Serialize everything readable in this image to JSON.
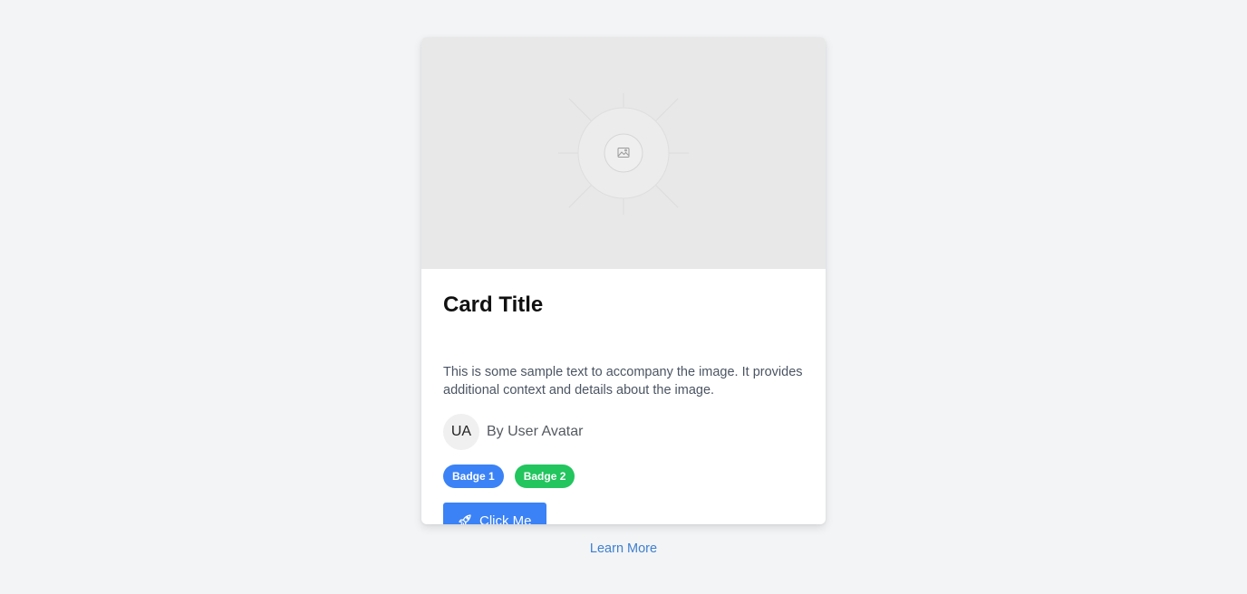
{
  "card": {
    "image_icon": "image-icon",
    "title": "Card Title",
    "text": "This is some sample text to accompany the image. It provides additional context and details about the image.",
    "author": {
      "initials": "UA",
      "name": "By User Avatar"
    },
    "badges": [
      {
        "label": "Badge 1",
        "color": "#3b82f6"
      },
      {
        "label": "Badge 2",
        "color": "#22c55e"
      }
    ],
    "button": {
      "label": "Click Me",
      "icon": "rocket-icon",
      "color": "#3b82f6"
    }
  },
  "footer": {
    "link_label": "Learn More",
    "link_color": "#3f7fd0"
  }
}
